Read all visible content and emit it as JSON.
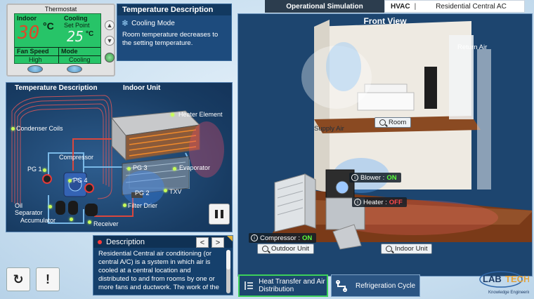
{
  "topbar": {
    "operational": "Operational Simulation",
    "hvac": "HVAC",
    "separator": "|",
    "system": "Residential Central AC"
  },
  "thermostat": {
    "title": "Thermostat",
    "indoor_label": "Indoor",
    "indoor_value": "30",
    "indoor_unit": "°C",
    "cooling_label": "Cooling",
    "setpoint_label": "Set Point",
    "setpoint_value": "25",
    "setpoint_unit": "°C",
    "fan_speed_label": "Fan Speed",
    "fan_speed_value": "High",
    "mode_label": "Mode",
    "mode_value": "Cooling"
  },
  "temp_description": {
    "title": "Temperature Description",
    "mode": "Cooling Mode",
    "text": "Room temperature decreases to the setting temperature."
  },
  "diagram": {
    "header_left": "Temperature Description",
    "header_right": "Indoor Unit",
    "labels": {
      "heater_element": "Heater Element",
      "condenser_coils": "Condenser Coils",
      "compressor": "Compressor",
      "pg1": "PG 1",
      "pg4": "PG 4",
      "pg3": "PG 3",
      "evaporator": "Evaporator",
      "pg2": "PG 2",
      "txv": "TXV",
      "oil_separator": "Oil\nSeparator",
      "accumulator": "Accumulator",
      "filter_drier": "Filter Drier",
      "receiver": "Receiver"
    }
  },
  "description": {
    "title": "Description",
    "prev": "<",
    "next": ">",
    "text": "Residential Central air conditioning (or central A/C) is a system in which air is cooled at a central location and distributed to and from rooms by one or more fans and ductwork. The work of the ..."
  },
  "front_view": {
    "title": "Front View",
    "return_air": "Return Air",
    "supply_air": "Supply Air",
    "room": "Room",
    "blower_label": "Blower :",
    "blower_state": "ON",
    "heater_label": "Heater :",
    "heater_state": "OFF",
    "compressor_label": "Compressor :",
    "compressor_state": "ON",
    "outdoor_unit": "Outdoor Unit",
    "indoor_unit": "Indoor Unit"
  },
  "tabs": {
    "heat_transfer": "Heat Transfer and Air Distribution",
    "refrigeration": "Refrigeration Cycle"
  },
  "logo": {
    "name": "LAB TECH",
    "tagline": "Knowledge Engineering"
  },
  "icons": [
    "snowflake-icon",
    "reset-icon",
    "alert-icon",
    "pause-icon",
    "magnifier-icon",
    "info-icon",
    "airflow-icon",
    "pipe-icon"
  ],
  "colors": {
    "lcd_green": "#27c468",
    "panel_blue": "#1d456f",
    "on_green": "#5bff3c",
    "off_red": "#ff4a4a",
    "active_tab_border": "#3ccf5a"
  }
}
